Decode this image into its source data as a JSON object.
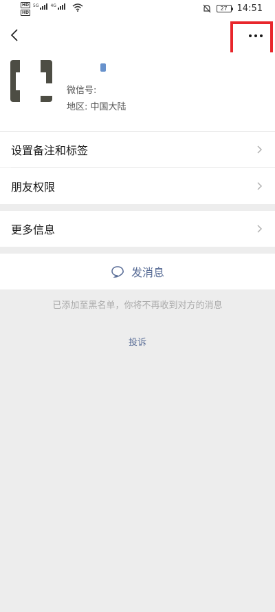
{
  "status_bar": {
    "network_badges": [
      "HD",
      "HD"
    ],
    "signal_1_label": "5G",
    "signal_2_label": "4G",
    "battery": "27",
    "time": "14:51"
  },
  "profile": {
    "wechat_id_label": "微信号: ",
    "wechat_id_value": "",
    "region_label": "地区: ",
    "region_value": "中国大陆"
  },
  "menu": {
    "remark_tags": "设置备注和标签",
    "friend_permissions": "朋友权限",
    "more_info": "更多信息"
  },
  "actions": {
    "send_message": "发消息"
  },
  "blacklist_notice": "已添加至黑名单，你将不再收到对方的消息",
  "report_link": "投诉",
  "colors": {
    "accent_link": "#576b95",
    "highlight_box": "#e8262b",
    "page_bg": "#ededed"
  }
}
